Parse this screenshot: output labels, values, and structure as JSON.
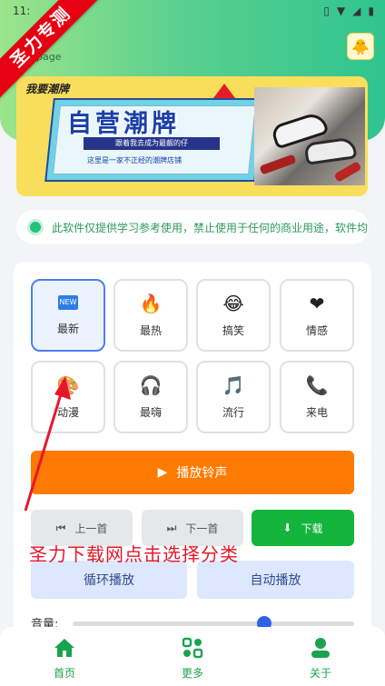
{
  "status_bar": {
    "time": "11:",
    "icons": [
      "vibrate-icon",
      "wifi-icon",
      "signal-icon",
      "battery-icon"
    ]
  },
  "ribbon": {
    "text": "圣力专测"
  },
  "header": {
    "page_label": "page",
    "badge_icon": "app-logo-icon"
  },
  "banner": {
    "tag": "我要潮牌",
    "title": "自营潮牌",
    "subtitle": "跟着我去成为最靓的仔",
    "subtitle2": "这里是一家不正经的潮牌店铺"
  },
  "notice": {
    "text": "此软件仅提供学习参考使用，禁止使用于任何的商业用途，软件均来"
  },
  "categories": [
    {
      "label": "最新",
      "icon": "NEW",
      "active": true
    },
    {
      "label": "最热",
      "icon": "🔥",
      "active": false
    },
    {
      "label": "搞笑",
      "icon": "😂",
      "active": false
    },
    {
      "label": "情感",
      "icon": "❤",
      "active": false
    },
    {
      "label": "动漫",
      "icon": "🎨",
      "active": false
    },
    {
      "label": "最嗨",
      "icon": "🎧",
      "active": false
    },
    {
      "label": "流行",
      "icon": "🎵",
      "active": false
    },
    {
      "label": "来电",
      "icon": "📞",
      "active": false
    }
  ],
  "controls": {
    "play": "播放铃声",
    "prev": "上一首",
    "next": "下一首",
    "download": "下载",
    "loop": "循环播放",
    "autoplay": "自动播放",
    "volume_label": "音量:",
    "volume_level": 0.68
  },
  "overlay_caption": "圣力下载网点击选择分类",
  "tabs": [
    {
      "label": "首页",
      "icon": "home-icon"
    },
    {
      "label": "更多",
      "icon": "more-icon"
    },
    {
      "label": "关于",
      "icon": "user-icon"
    }
  ],
  "colors": {
    "accent_green": "#1aa34e",
    "play_orange": "#ff7a00",
    "download_green": "#13b53c",
    "ribbon_red": "#e60012"
  }
}
